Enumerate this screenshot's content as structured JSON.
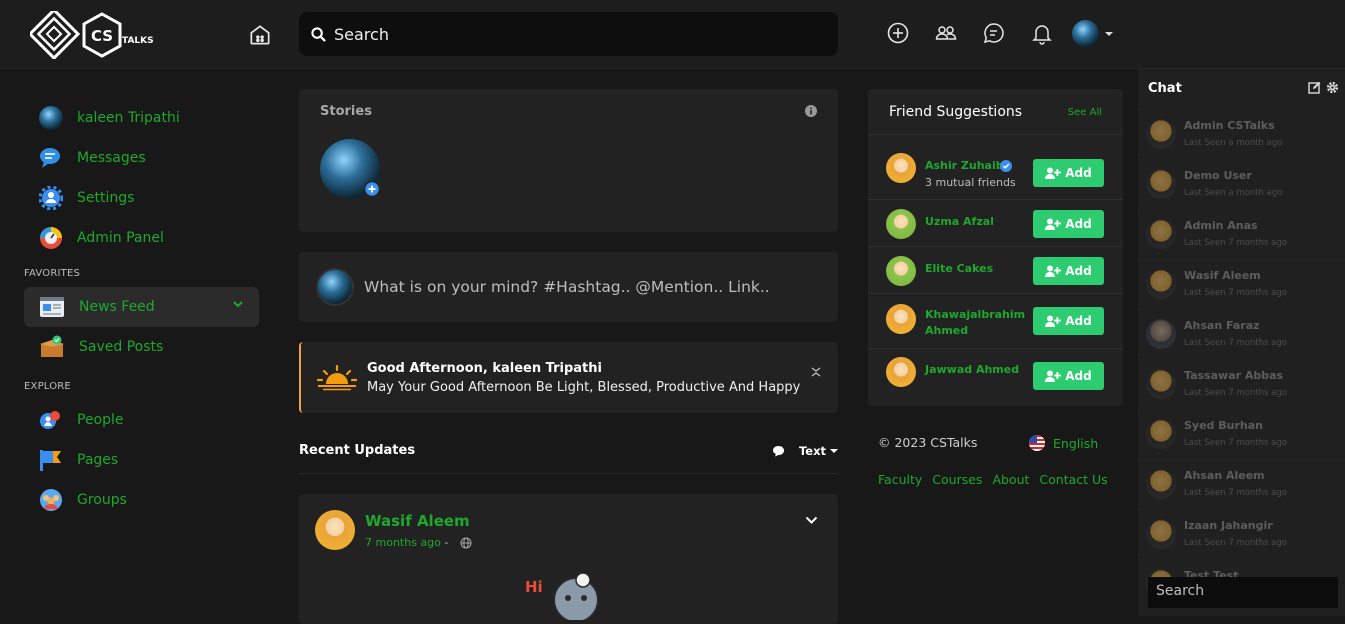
{
  "brand": {
    "logo_text": "CS",
    "logo_suffix": "TALKS"
  },
  "header": {
    "search_label": "Search"
  },
  "user": {
    "name": "kaleen Tripathi"
  },
  "leftnav": {
    "top": [
      {
        "label": "kaleen Tripathi",
        "icon": "user-avatar"
      },
      {
        "label": "Messages",
        "icon": "messages-icon"
      },
      {
        "label": "Settings",
        "icon": "settings-icon"
      },
      {
        "label": "Admin Panel",
        "icon": "admin-panel-icon"
      }
    ],
    "favorites_title": "FAVORITES",
    "favorites": [
      {
        "label": "News Feed",
        "icon": "newspaper-icon"
      },
      {
        "label": "Saved Posts",
        "icon": "saved-box-icon"
      }
    ],
    "explore_title": "EXPLORE",
    "explore": [
      {
        "label": "People",
        "icon": "people-icon"
      },
      {
        "label": "Pages",
        "icon": "flag-icon"
      },
      {
        "label": "Groups",
        "icon": "groups-icon"
      }
    ]
  },
  "stories": {
    "title": "Stories"
  },
  "composer": {
    "placeholder": "What is on your mind? #Hashtag.. @Mention.. Link.."
  },
  "greeting": {
    "title": "Good Afternoon, kaleen Tripathi",
    "message": "May Your Good Afternoon Be Light, Blessed, Productive And Happy"
  },
  "recent": {
    "title": "Recent Updates",
    "filter": "Text"
  },
  "post": {
    "author": "Wasif Aleem",
    "time": "7 months ago",
    "sep": "-",
    "sticker_text": "Hi"
  },
  "friends": {
    "title": "Friend Suggestions",
    "see_all": "See All",
    "add_label": "Add",
    "items": [
      {
        "name": "Ashir Zuhaib",
        "sub": "3 mutual friends",
        "verified": true
      },
      {
        "name": "Uzma Afzal"
      },
      {
        "name": "Elite Cakes"
      },
      {
        "name_line1": "Khawajalbrahim",
        "name_line2": "Ahmed"
      },
      {
        "name": "Jawwad Ahmed"
      }
    ]
  },
  "footer": {
    "copyright": "© 2023 CSTalks",
    "language": "English",
    "links": [
      "Faculty",
      "Courses",
      "About",
      "Contact Us"
    ]
  },
  "chat": {
    "title": "Chat",
    "search_placeholder": "Search",
    "contacts": [
      {
        "name": "Admin CSTalks",
        "seen": "Last Seen a month ago"
      },
      {
        "name": "Demo User",
        "seen": "Last Seen a month ago"
      },
      {
        "name": "Admin Anas",
        "seen": "Last Seen 7 months ago"
      },
      {
        "name": "Wasif Aleem",
        "seen": "Last Seen 7 months ago"
      },
      {
        "name": "Ahsan Faraz",
        "seen": "Last Seen 7 months ago"
      },
      {
        "name": "Tassawar Abbas",
        "seen": "Last Seen 7 months ago"
      },
      {
        "name": "Syed Burhan",
        "seen": "Last Seen 7 months ago"
      },
      {
        "name": "Ahsan Aleem",
        "seen": "Last Seen 7 months ago"
      },
      {
        "name": "Izaan Jahangir",
        "seen": "Last Seen 7 months ago"
      },
      {
        "name": "Test Test",
        "seen": ""
      }
    ]
  },
  "colors": {
    "accent_green": "#1fa82e",
    "add_button": "#2ecc71",
    "greeting_border": "#f0a23a"
  }
}
